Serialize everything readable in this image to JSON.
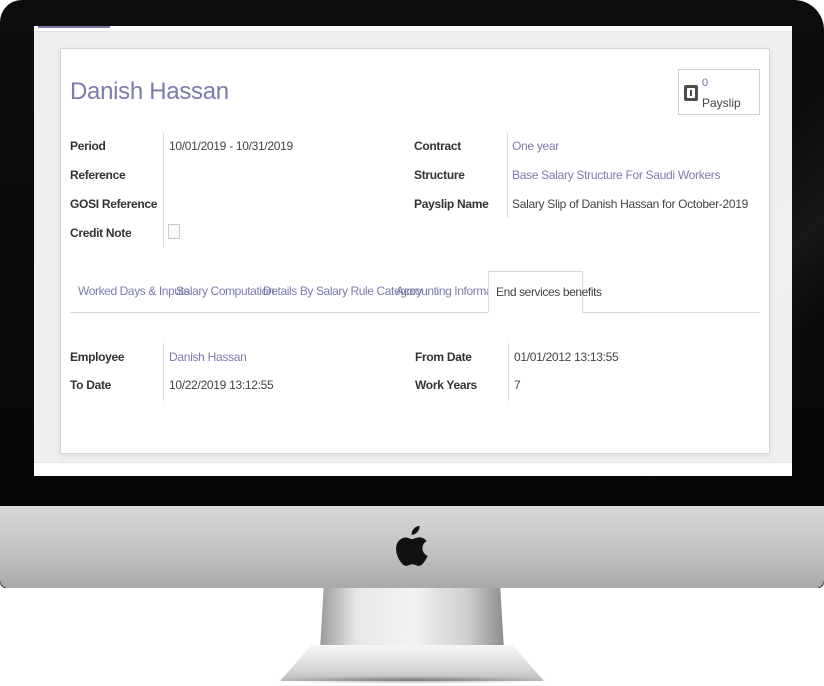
{
  "employee_name": "Danish Hassan",
  "smart_button": {
    "count": "0",
    "label": "Payslip"
  },
  "fields_left": [
    {
      "label": "Period",
      "value": "10/01/2019 - 10/31/2019"
    },
    {
      "label": "Reference",
      "value": ""
    },
    {
      "label": "GOSI Reference",
      "value": ""
    },
    {
      "label": "Credit Note",
      "value": ""
    }
  ],
  "fields_right": [
    {
      "label": "Contract",
      "value": "One year"
    },
    {
      "label": "Structure",
      "value": "Base Salary Structure For Saudi Workers"
    },
    {
      "label": "Payslip Name",
      "value": "Salary Slip of Danish Hassan for October-2019"
    }
  ],
  "tabs": [
    {
      "label": "Worked Days & Inputs"
    },
    {
      "label": "Salary Computation"
    },
    {
      "label": "Details By Salary Rule Category"
    },
    {
      "label": "Accounting Information"
    },
    {
      "label": "End services benefits",
      "active": true
    }
  ],
  "tab_content": {
    "left": [
      {
        "label": "Employee",
        "value": "Danish Hassan"
      },
      {
        "label": "To Date",
        "value": "10/22/2019 13:12:55"
      }
    ],
    "right": [
      {
        "label": "From Date",
        "value": "01/01/2012 13:13:55"
      },
      {
        "label": "Work Years",
        "value": "7"
      }
    ]
  },
  "colors": {
    "accent": "#7c7bad",
    "text": "#444444",
    "bezel": "#0a0a0a"
  },
  "icons": {
    "smart_button": "payslip-icon",
    "brand": "apple-logo-icon"
  }
}
